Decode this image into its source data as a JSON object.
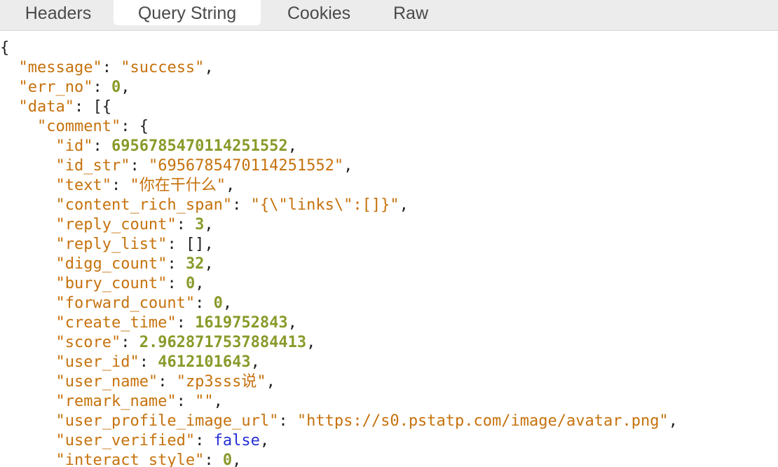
{
  "tabs": {
    "headers": "Headers",
    "query_string": "Query String",
    "cookies": "Cookies",
    "raw": "Raw",
    "active": "query_string"
  },
  "colors": {
    "key": "#c6720d",
    "string": "#c6720d",
    "number": "#8a9a2a",
    "boolean": "#2631d6",
    "punct": "#1f1f1f"
  },
  "json_view": {
    "open_root": "{",
    "message_key": "\"message\"",
    "message_val": "\"success\"",
    "err_no_key": "\"err_no\"",
    "err_no_val": "0",
    "data_key": "\"data\"",
    "data_open": "[{",
    "comment_key": "\"comment\"",
    "comment_open": "{",
    "fields": [
      {
        "key": "\"id\"",
        "val": "6956785470114251552",
        "type": "n"
      },
      {
        "key": "\"id_str\"",
        "val": "\"6956785470114251552\"",
        "type": "s"
      },
      {
        "key": "\"text\"",
        "val": "\"你在干什么\"",
        "type": "s"
      },
      {
        "key": "\"content_rich_span\"",
        "val": "\"{\\\"links\\\":[]}\"",
        "type": "s"
      },
      {
        "key": "\"reply_count\"",
        "val": "3",
        "type": "n"
      },
      {
        "key": "\"reply_list\"",
        "val": "[]",
        "type": "p"
      },
      {
        "key": "\"digg_count\"",
        "val": "32",
        "type": "n"
      },
      {
        "key": "\"bury_count\"",
        "val": "0",
        "type": "n"
      },
      {
        "key": "\"forward_count\"",
        "val": "0",
        "type": "n"
      },
      {
        "key": "\"create_time\"",
        "val": "1619752843",
        "type": "n"
      },
      {
        "key": "\"score\"",
        "val": "2.9628717537884413",
        "type": "n"
      },
      {
        "key": "\"user_id\"",
        "val": "4612101643",
        "type": "n"
      },
      {
        "key": "\"user_name\"",
        "val": "\"zp3sss说\"",
        "type": "s"
      },
      {
        "key": "\"remark_name\"",
        "val": "\"\"",
        "type": "s"
      },
      {
        "key": "\"user_profile_image_url\"",
        "val": "\"https://s0.pstatp.com/image/avatar.png\"",
        "type": "s"
      },
      {
        "key": "\"user_verified\"",
        "val": "false",
        "type": "b"
      },
      {
        "key": "\"interact_style\"",
        "val": "0",
        "type": "n"
      }
    ]
  }
}
